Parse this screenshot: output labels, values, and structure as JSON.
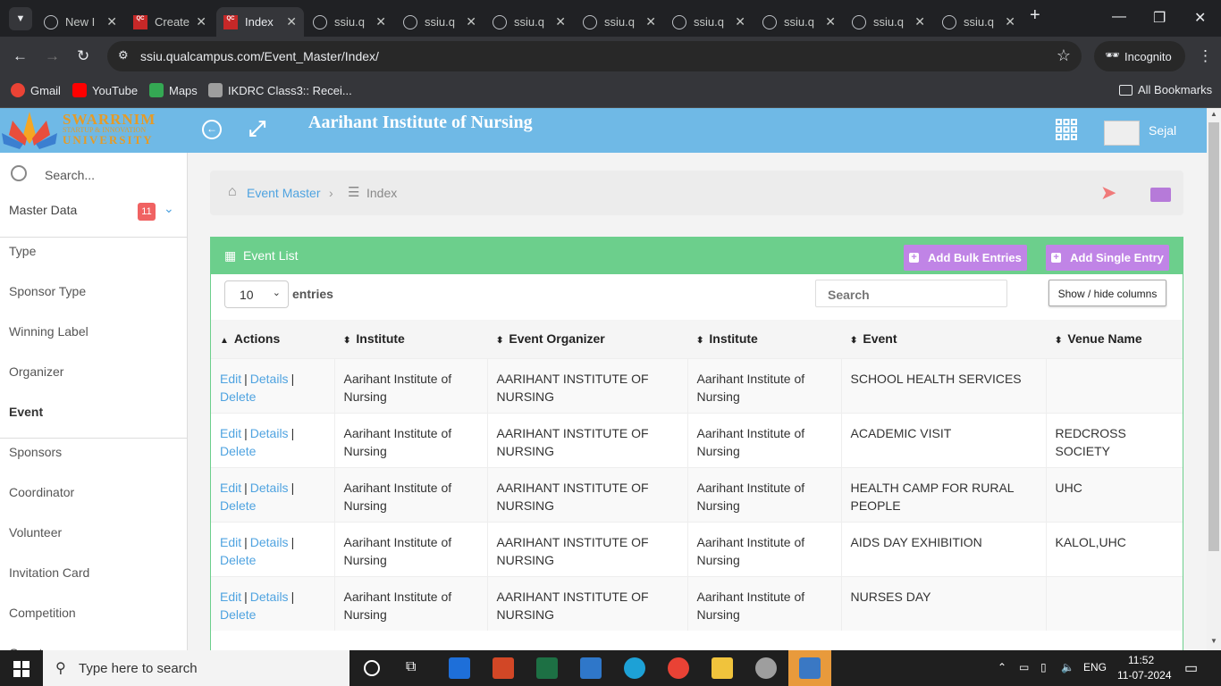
{
  "browser": {
    "tabs": [
      {
        "title": "New I",
        "icon": "chrome-tab-icon",
        "active": false
      },
      {
        "title": "Create",
        "icon": "qualcampus-icon",
        "active": false
      },
      {
        "title": "Index",
        "icon": "qualcampus-icon",
        "active": true
      },
      {
        "title": "ssiu.q",
        "icon": "globe-icon",
        "active": false
      },
      {
        "title": "ssiu.q",
        "icon": "globe-icon",
        "active": false
      },
      {
        "title": "ssiu.q",
        "icon": "globe-icon",
        "active": false
      },
      {
        "title": "ssiu.q",
        "icon": "globe-icon",
        "active": false
      },
      {
        "title": "ssiu.q",
        "icon": "globe-icon",
        "active": false
      },
      {
        "title": "ssiu.q",
        "icon": "globe-icon",
        "active": false
      },
      {
        "title": "ssiu.q",
        "icon": "globe-icon",
        "active": false
      },
      {
        "title": "ssiu.q",
        "icon": "globe-icon",
        "active": false
      }
    ],
    "url": "ssiu.qualcampus.com/Event_Master/Index/",
    "incognito_label": "Incognito",
    "bookmarks": [
      {
        "label": "Gmail",
        "color": "#ea4335"
      },
      {
        "label": "YouTube",
        "color": "#ff0000"
      },
      {
        "label": "Maps",
        "color": "#34a853"
      },
      {
        "label": "IKDRC Class3:: Recei...",
        "color": "#9e9e9e"
      }
    ],
    "all_bookmarks": "All Bookmarks"
  },
  "header": {
    "logo_line1": "SWARRNIM",
    "logo_line2": "STARTUP & INNOVATION",
    "logo_line3": "UNIVERSITY",
    "institute": "Aarihant Institute of Nursing",
    "user": "Sejal"
  },
  "sidebar": {
    "search_placeholder": "Search...",
    "master_label": "Master Data",
    "master_count": "11",
    "items": [
      "Type",
      "Sponsor Type",
      "Winning Label",
      "Organizer",
      "Event",
      "Sponsors",
      "Coordinator",
      "Volunteer",
      "Invitation Card",
      "Competition",
      "Guest"
    ]
  },
  "breadcrumb": {
    "home": "Event Master",
    "current": "Index"
  },
  "panel": {
    "title": "Event List",
    "bulk_button": "Add Bulk Entries",
    "single_button": "Add Single Entry",
    "page_size": "10",
    "entries_label": "entries",
    "search_placeholder": "Search",
    "show_hide": "Show / hide columns"
  },
  "table": {
    "columns": [
      "Actions",
      "Institute",
      "Event Organizer",
      "Institute",
      "Event",
      "Venue Name"
    ],
    "edit": "Edit",
    "details": "Details",
    "delete": "Delete",
    "sep": "|",
    "rows": [
      {
        "institute": "Aarihant Institute of Nursing",
        "organizer": "AARIHANT INSTITUTE OF NURSING",
        "institute2": "Aarihant Institute of Nursing",
        "event": "SCHOOL HEALTH SERVICES",
        "venue": ""
      },
      {
        "institute": "Aarihant Institute of Nursing",
        "organizer": "AARIHANT INSTITUTE OF NURSING",
        "institute2": "Aarihant Institute of Nursing",
        "event": "ACADEMIC VISIT",
        "venue": "REDCROSS SOCIETY"
      },
      {
        "institute": "Aarihant Institute of Nursing",
        "organizer": "AARIHANT INSTITUTE OF NURSING",
        "institute2": "Aarihant Institute of Nursing",
        "event": "HEALTH CAMP FOR RURAL PEOPLE",
        "venue": "UHC"
      },
      {
        "institute": "Aarihant Institute of Nursing",
        "organizer": "AARIHANT INSTITUTE OF NURSING",
        "institute2": "Aarihant Institute of Nursing",
        "event": "AIDS DAY EXHIBITION",
        "venue": "KALOL,UHC"
      },
      {
        "institute": "Aarihant Institute of Nursing",
        "organizer": "AARIHANT INSTITUTE OF NURSING",
        "institute2": "Aarihant Institute of Nursing",
        "event": "NURSES DAY",
        "venue": ""
      }
    ]
  },
  "taskbar": {
    "search_placeholder": "Type here to search",
    "lang": "ENG",
    "time": "11:52",
    "date": "11-07-2024"
  },
  "colors": {
    "header": "#6fb9e6",
    "panel": "#6ccf8c",
    "button": "#c084e6",
    "link": "#4fa3e0"
  }
}
